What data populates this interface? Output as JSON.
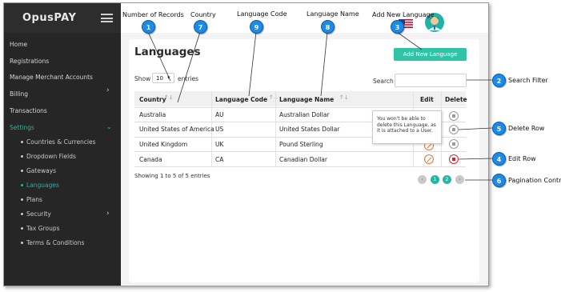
{
  "app": {
    "brand": "OpusPAY"
  },
  "sidebar": {
    "items": [
      {
        "label": "Home"
      },
      {
        "label": "Registrations"
      },
      {
        "label": "Manage Merchant Accounts"
      },
      {
        "label": "Billing"
      },
      {
        "label": "Transactions"
      },
      {
        "label": "Settings"
      }
    ],
    "sub_items": [
      {
        "label": "Countries & Currencies"
      },
      {
        "label": "Dropdown Fields"
      },
      {
        "label": "Gateways"
      },
      {
        "label": "Languages"
      },
      {
        "label": "Plans"
      },
      {
        "label": "Security"
      },
      {
        "label": "Tax Groups"
      },
      {
        "label": "Terms & Conditions"
      }
    ]
  },
  "page": {
    "title": "Languages",
    "add_button": "Add New Language",
    "show_label": "Show",
    "entries_value": "10",
    "entries_label": "entries",
    "search_label": "Search",
    "search_value": "",
    "footer_info": "Showing 1 to 5 of 5 entries",
    "pages": [
      "1",
      "2"
    ]
  },
  "table": {
    "headers": [
      "Country",
      "Language Code",
      "Language Name",
      "Edit",
      "Delete"
    ],
    "rows": [
      [
        "Australia",
        "AU",
        "Australian Dollar"
      ],
      [
        "United States of America",
        "US",
        "United States Dollar"
      ],
      [
        "United Kingdom",
        "UK",
        "Pound Sterling"
      ],
      [
        "Canada",
        "CA",
        "Canadian Dollar"
      ]
    ]
  },
  "tooltip": {
    "text": "You won't be able to delete this Language, as it is attached to a User."
  },
  "annotations": {
    "top": [
      "Number of Records",
      "Country",
      "Language Code",
      "Language Name",
      "Add New Language"
    ],
    "right": [
      "Search Filter",
      "Delete Row",
      "Edit Row",
      "Pagination Control"
    ],
    "numbers": [
      "1",
      "7",
      "9",
      "8",
      "3",
      "2",
      "5",
      "4",
      "6"
    ]
  },
  "colors": {
    "accent": "#27b5a2",
    "callout": "#1a8be8",
    "sidebar": "#262626",
    "danger": "#d8232a",
    "edit": "#e8742c"
  }
}
